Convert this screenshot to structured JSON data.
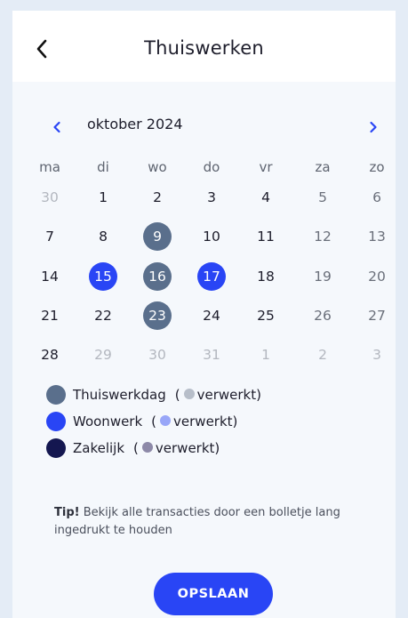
{
  "header": {
    "title": "Thuiswerken",
    "back_icon": "chevron-left-icon"
  },
  "calendar": {
    "month_label": "oktober 2024",
    "prev_icon": "chevron-left-icon",
    "next_icon": "chevron-right-icon",
    "weekdays": [
      "ma",
      "di",
      "wo",
      "do",
      "vr",
      "za",
      "zo"
    ],
    "weeks": [
      [
        {
          "d": "30",
          "s": "muted"
        },
        {
          "d": "1",
          "s": ""
        },
        {
          "d": "2",
          "s": ""
        },
        {
          "d": "3",
          "s": ""
        },
        {
          "d": "4",
          "s": ""
        },
        {
          "d": "5",
          "s": "weekend"
        },
        {
          "d": "6",
          "s": "weekend"
        }
      ],
      [
        {
          "d": "7",
          "s": ""
        },
        {
          "d": "8",
          "s": ""
        },
        {
          "d": "9",
          "s": "thuis"
        },
        {
          "d": "10",
          "s": ""
        },
        {
          "d": "11",
          "s": ""
        },
        {
          "d": "12",
          "s": "weekend"
        },
        {
          "d": "13",
          "s": "weekend"
        }
      ],
      [
        {
          "d": "14",
          "s": ""
        },
        {
          "d": "15",
          "s": "woon"
        },
        {
          "d": "16",
          "s": "thuis"
        },
        {
          "d": "17",
          "s": "woon"
        },
        {
          "d": "18",
          "s": ""
        },
        {
          "d": "19",
          "s": "weekend"
        },
        {
          "d": "20",
          "s": "weekend"
        }
      ],
      [
        {
          "d": "21",
          "s": ""
        },
        {
          "d": "22",
          "s": ""
        },
        {
          "d": "23",
          "s": "thuis"
        },
        {
          "d": "24",
          "s": ""
        },
        {
          "d": "25",
          "s": ""
        },
        {
          "d": "26",
          "s": "weekend"
        },
        {
          "d": "27",
          "s": "weekend"
        }
      ],
      [
        {
          "d": "28",
          "s": ""
        },
        {
          "d": "29",
          "s": "muted"
        },
        {
          "d": "30",
          "s": "muted"
        },
        {
          "d": "31",
          "s": "muted"
        },
        {
          "d": "1",
          "s": "muted"
        },
        {
          "d": "2",
          "s": "muted"
        },
        {
          "d": "3",
          "s": "muted"
        }
      ]
    ]
  },
  "legend": [
    {
      "label": "Thuiswerkdag",
      "color": "#5a6f8c",
      "processed_color": "#b7bec9",
      "processed_label": "verwerkt"
    },
    {
      "label": "Woonwerk",
      "color": "#2945f5",
      "processed_color": "#98a6f8",
      "processed_label": "verwerkt"
    },
    {
      "label": "Zakelijk",
      "color": "#141750",
      "processed_color": "#8d89a8",
      "processed_label": "verwerkt"
    }
  ],
  "tip": {
    "bold": "Tip!",
    "text": " Bekijk alle transacties door een bolletje lang ingedrukt te houden"
  },
  "save_label": "OPSLAAN",
  "colors": {
    "accent": "#2945f5",
    "thuis": "#5a6f8c"
  }
}
